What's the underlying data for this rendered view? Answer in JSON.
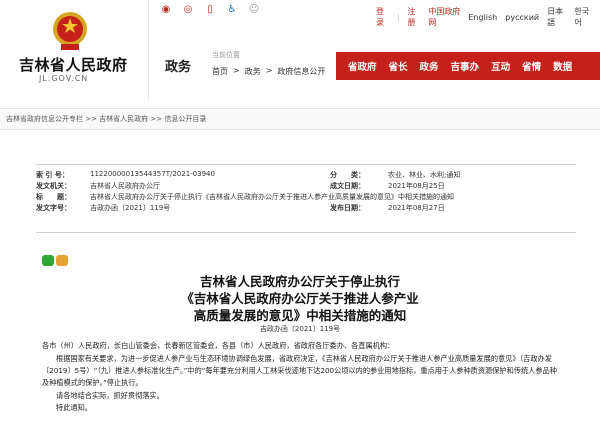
{
  "header": {
    "site_name": "吉林省人民政府",
    "site_domain": "JL.GOV.CN",
    "section": "政务",
    "social_icons": [
      "weibo-icon",
      "wechat-icon",
      "mobile-icon",
      "accessibility-icon",
      "elder-care-icon"
    ],
    "top_links": {
      "login": "登录",
      "register": "注册",
      "gov_site": "中国政府网",
      "english": "English",
      "russian": "русский",
      "japanese": "日本語",
      "korean": "한국어"
    },
    "location_label": "当前位置",
    "crumb": [
      "首页",
      "政务",
      "政府信息公开"
    ],
    "nav": [
      "省政府",
      "省长",
      "政务",
      "吉事办",
      "互动",
      "省情",
      "数据"
    ]
  },
  "path_bar": "吉林省政府信息公开专栏 >> 吉林省人民政府 >> 信息公开目录",
  "meta": {
    "index_label": "索 引 号：",
    "index_value": "11220000013544357T/2021-03940",
    "category_label": "分　　类：",
    "category_value": "农业、林业、水利;通知",
    "issuer_label": "发文机关：",
    "issuer_value": "吉林省人民政府办公厅",
    "date_label": "成文日期：",
    "date_value": "2021年08月25日",
    "subject_label": "标　　题：",
    "subject_value": "吉林省人民政府办公厅关于停止执行《吉林省人民政府办公厅关于推进人参产业高质量发展的意见》中相关措施的通知",
    "docno_label": "发文字号：",
    "docno_value": "吉政办函〔2021〕119号",
    "publish_label": "发布日期：",
    "publish_value": "2021年08月27日"
  },
  "article": {
    "title_line1": "吉林省人民政府办公厅关于停止执行",
    "title_line2": "《吉林省人民政府办公厅关于推进人参产业",
    "title_line3": "高质量发展的意见》中相关措施的通知",
    "doc_number": "吉政办函〔2021〕119号",
    "p1": "各市（州）人民政府，长白山管委会，长春新区管委会，各县（市）人民政府，省政府各厅委办、各直属机构：",
    "p2": "根据国家有关要求，为进一步促进人参产业与生态环境协调绿色发展，省政府决定，《吉林省人民政府办公厅关于推进人参产业高质量发展的意见》（吉政办发〔2019〕5号）“（九）推进人参标准化生产。”中的“每年要充分利用人工林采伐迹地下达200公顷以内的参业用地指标，重点用于人参种质资源保护和传统人参品种及种植模式的保护。”停止执行。",
    "p3": "请各地结合实际，抓好贯彻落实。",
    "p4": "特此通知。",
    "p5": ""
  }
}
